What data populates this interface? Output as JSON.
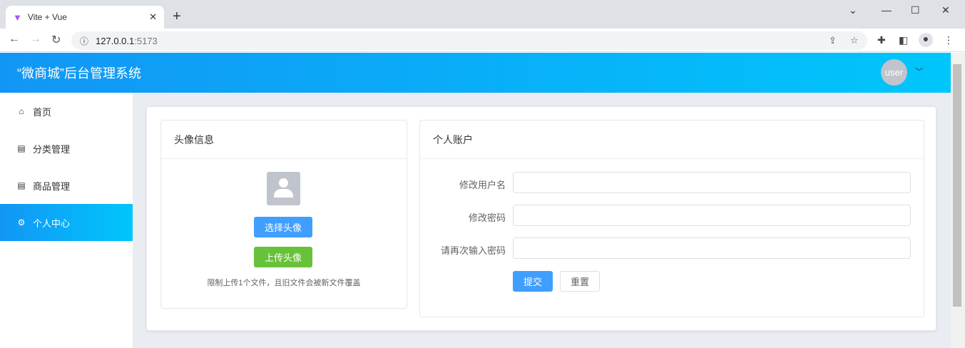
{
  "browser": {
    "tab_title": "Vite + Vue",
    "url_host": "127.0.0.1",
    "url_port": ":5173"
  },
  "header": {
    "title": "“微商城”后台管理系统",
    "avatar_text": "user"
  },
  "sidebar": {
    "items": [
      {
        "label": "首页",
        "icon": "home-icon"
      },
      {
        "label": "分类管理",
        "icon": "clipboard-icon"
      },
      {
        "label": "商品管理",
        "icon": "clipboard-icon"
      },
      {
        "label": "个人中心",
        "icon": "gear-icon",
        "active": true
      }
    ]
  },
  "avatar_card": {
    "title": "头像信息",
    "select_label": "选择头像",
    "upload_label": "上传头像",
    "note": "限制上传1个文件，且旧文件会被新文件覆盖"
  },
  "account_card": {
    "title": "个人账户",
    "fields": [
      {
        "label": "修改用户名",
        "value": ""
      },
      {
        "label": "修改密码",
        "value": ""
      },
      {
        "label": "请再次输入密码",
        "value": ""
      }
    ],
    "submit_label": "提交",
    "reset_label": "重置"
  },
  "colors": {
    "primary": "#409eff",
    "success": "#67c23a",
    "header_start": "#1296f5",
    "header_end": "#00c6fb"
  }
}
